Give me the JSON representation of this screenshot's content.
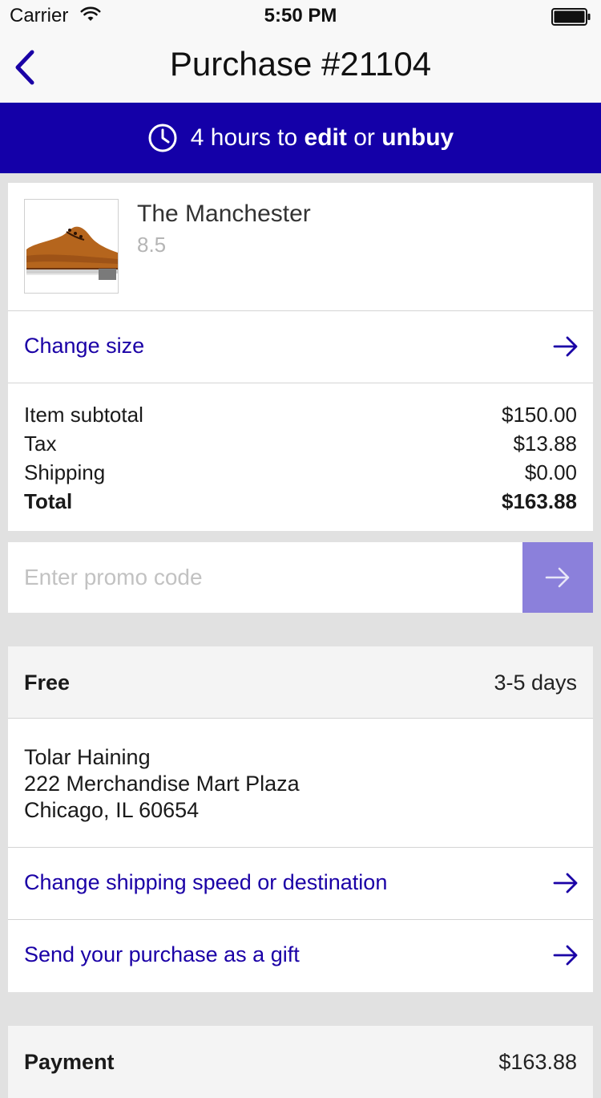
{
  "status_bar": {
    "carrier": "Carrier",
    "time": "5:50 PM"
  },
  "nav": {
    "title": "Purchase #21104"
  },
  "banner": {
    "prefix": "4 hours to ",
    "edit": "edit",
    "or": " or ",
    "unbuy": "unbuy"
  },
  "product": {
    "name": "The Manchester",
    "size": "8.5",
    "change_size_label": "Change size"
  },
  "summary": {
    "lines": [
      {
        "label": "Item subtotal",
        "value": "$150.00"
      },
      {
        "label": "Tax",
        "value": "$13.88"
      },
      {
        "label": "Shipping",
        "value": "$0.00"
      }
    ],
    "total": {
      "label": "Total",
      "value": "$163.88"
    }
  },
  "promo": {
    "placeholder": "Enter promo code"
  },
  "shipping": {
    "method": "Free",
    "eta": "3-5 days",
    "address": {
      "name": "Tolar Haining",
      "street": "222 Merchandise Mart Plaza",
      "city": "Chicago, IL 60654"
    },
    "change_label": "Change shipping speed or destination",
    "gift_label": "Send your purchase as a gift"
  },
  "payment": {
    "label": "Payment",
    "amount": "$163.88"
  },
  "colors": {
    "accent": "#1400a8",
    "link": "#1a00a6",
    "promo_button": "#8b80db",
    "background": "#e1e1e1"
  },
  "icons": {
    "back": "chevron-left-icon",
    "timer": "clock-icon",
    "arrow": "arrow-right-icon",
    "product": "shoe-image"
  }
}
